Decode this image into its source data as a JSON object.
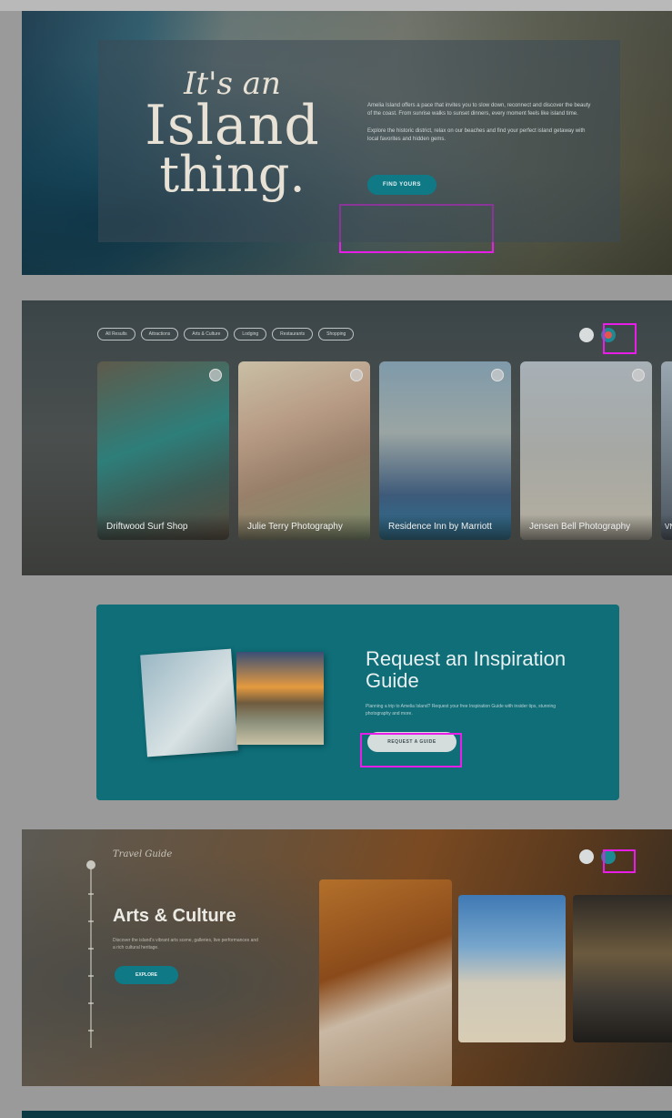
{
  "hero": {
    "title_line1": "It's an",
    "title_line2": "Island",
    "title_line3": "thing.",
    "paragraph1": "Amelia Island offers a pace that invites you to slow down, reconnect and discover the beauty of the coast. From sunrise walks to sunset dinners, every moment feels like island time.",
    "paragraph2": "Explore the historic district, relax on our beaches and find your perfect island getaway with local favorites and hidden gems.",
    "button_label": "FIND YOURS"
  },
  "listings": {
    "filters": [
      "All Results",
      "Attractions",
      "Arts & Culture",
      "Lodging",
      "Restaurants",
      "Shopping"
    ],
    "cards": [
      {
        "title": "Driftwood Surf Shop",
        "image": "surf-shop-photo"
      },
      {
        "title": "Julie Terry Photography",
        "image": "floral-bride-photo"
      },
      {
        "title": "Residence Inn by Marriott",
        "image": "hotel-pool-photo"
      },
      {
        "title": "Jensen Bell Photography",
        "image": "beach-dunes-photo"
      },
      {
        "title": "VNS",
        "image": "partial-card-photo"
      }
    ]
  },
  "guide": {
    "title": "Request an Inspiration Guide",
    "text": "Planning a trip to Amelia Island? Request your free Inspiration Guide with insider tips, stunning photography and more.",
    "button_label": "REQUEST A GUIDE"
  },
  "arts": {
    "eyebrow": "Travel Guide",
    "title": "Arts & Culture",
    "text": "Discover the island's vibrant arts scene, galleries, live performances and a rich cultural heritage.",
    "button_label": "EXPLORE"
  },
  "colors": {
    "teal": "#0f7a86",
    "guide_bg": "#0f6e78",
    "highlight": "#e81ee8"
  }
}
